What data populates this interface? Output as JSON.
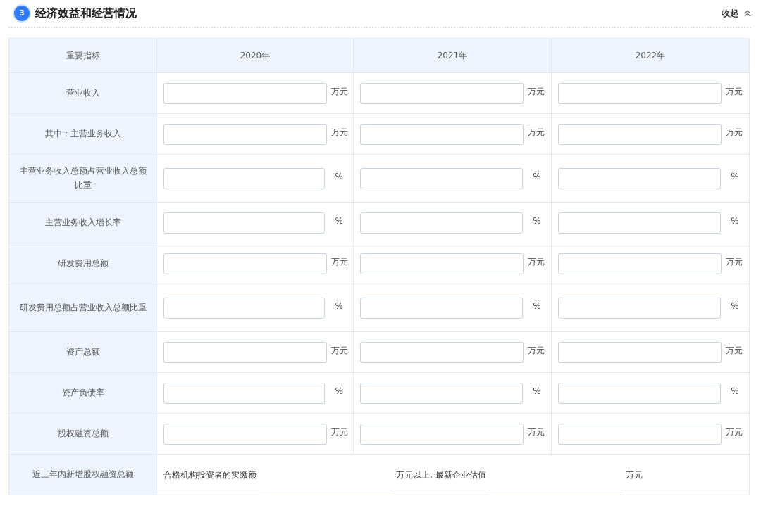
{
  "section": {
    "number": "3",
    "title": "经济效益和经营情况",
    "collapse": "收起"
  },
  "table": {
    "columns": [
      "重要指标",
      "2020年",
      "2021年",
      "2022年"
    ],
    "rows": [
      {
        "kind": "fields",
        "label": "营业收入",
        "units": [
          "万元",
          "万元",
          "万元"
        ]
      },
      {
        "kind": "fields",
        "label": "其中：主营业务收入",
        "units": [
          "万元",
          "万元",
          "万元"
        ]
      },
      {
        "kind": "fields",
        "label": "主营业务收入总额占营业收入总额比重",
        "units": [
          "%",
          "%",
          "%"
        ]
      },
      {
        "kind": "fields",
        "label": "主营业务收入增长率",
        "units": [
          "%",
          "%",
          "%"
        ]
      },
      {
        "kind": "fields",
        "label": "研发费用总额",
        "units": [
          "万元",
          "万元",
          "万元"
        ]
      },
      {
        "kind": "fields",
        "label": "研发费用总额占营业收入总额比重",
        "units": [
          "%",
          "%",
          "%"
        ]
      },
      {
        "kind": "fields",
        "label": "资产总额",
        "units": [
          "万元",
          "万元",
          "万元"
        ]
      },
      {
        "kind": "fields",
        "label": "资产负债率",
        "units": [
          "%",
          "%",
          "%"
        ]
      },
      {
        "kind": "fields",
        "label": "股权融资总额",
        "units": [
          "万元",
          "万元",
          "万元"
        ]
      },
      {
        "kind": "inline",
        "label": "近三年内新增股权融资总额",
        "texts": [
          "合格机构投资者的实缴额",
          "万元以上, 最新企业估值",
          "万元"
        ]
      }
    ]
  }
}
